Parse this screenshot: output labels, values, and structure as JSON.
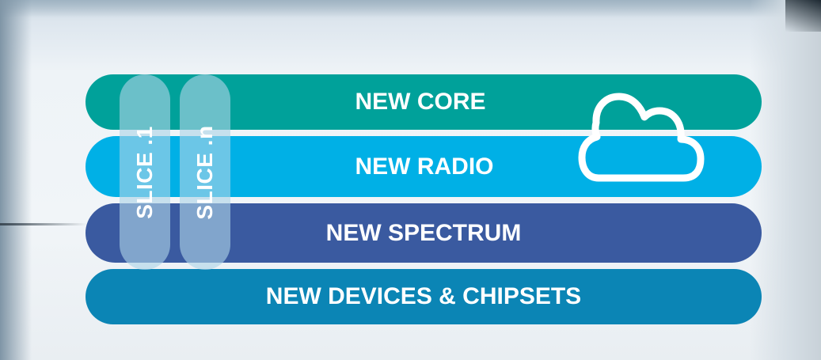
{
  "layers": {
    "core": "NEW CORE",
    "radio": "NEW RADIO",
    "spectrum": "NEW SPECTRUM",
    "devices": "NEW DEVICES & CHIPSETS"
  },
  "slices": {
    "first": "SLICE .1",
    "last": "SLICE .n"
  },
  "icons": {
    "cloud": "cloud-icon"
  },
  "colors": {
    "core": "#00a19a",
    "radio": "#00b0e6",
    "spectrum": "#3a5aa0",
    "devices": "#0b85b5"
  }
}
